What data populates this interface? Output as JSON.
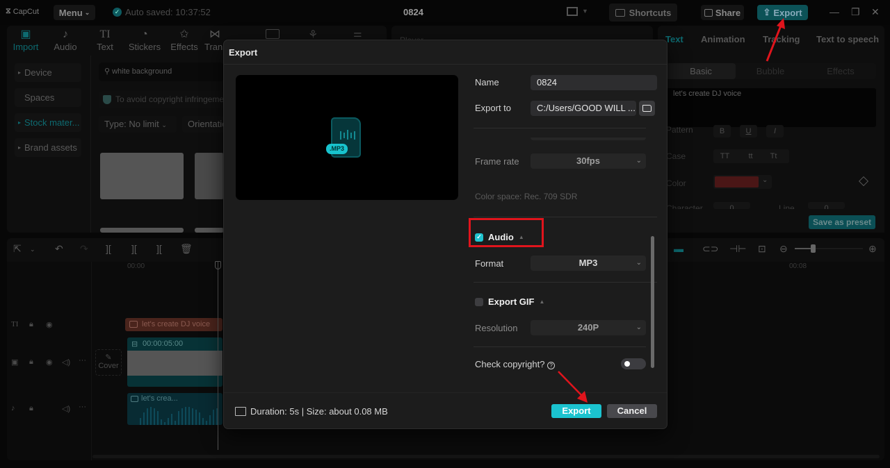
{
  "app": {
    "logo": "CapCut",
    "menu_label": "Menu",
    "autosave": "Auto saved: 10:37:52",
    "project_title": "0824",
    "shortcuts_label": "Shortcuts",
    "share_label": "Share",
    "export_label": "Export"
  },
  "toolbar": {
    "tabs": [
      {
        "label": "Import",
        "icon": "import-icon",
        "glyph": "▣",
        "active": true
      },
      {
        "label": "Audio",
        "icon": "audio-icon",
        "glyph": "♪"
      },
      {
        "label": "Text",
        "icon": "text-icon",
        "glyph": "TI"
      },
      {
        "label": "Stickers",
        "icon": "sticker-icon",
        "glyph": "◔"
      },
      {
        "label": "Effects",
        "icon": "effects-icon",
        "glyph": "✩"
      },
      {
        "label": "Transitions",
        "icon": "transition-icon",
        "glyph": "⋈"
      }
    ]
  },
  "sidebar": {
    "items": [
      {
        "label": "Device",
        "arrow": "▸"
      },
      {
        "label": "Spaces",
        "arrow": ""
      },
      {
        "label": "Stock mater...",
        "arrow": "▸",
        "active": true
      },
      {
        "label": "Brand assets",
        "arrow": "▸"
      }
    ]
  },
  "media": {
    "search_value": "white background",
    "notice": "To avoid copyright infringement",
    "filter_type": "Type: No limit",
    "filter_orientation": "Orientation"
  },
  "player": {
    "title": "Player"
  },
  "right_panel": {
    "tabs": [
      "Text",
      "Animation",
      "Tracking",
      "Text to speech"
    ],
    "segments": [
      "Basic",
      "Bubble",
      "Effects"
    ],
    "text_value": "let's create DJ voice",
    "pattern_label": "Pattern",
    "pattern_buttons": [
      "B",
      "U",
      "I"
    ],
    "case_label": "Case",
    "case_buttons": [
      "TT",
      "tt",
      "Tt"
    ],
    "color_label": "Color",
    "color_value": "#4a1616",
    "character_label": "Character",
    "character_value": "0",
    "line_label": "Line",
    "line_value": "0",
    "save_preset_label": "Save as preset"
  },
  "timeline": {
    "ruler_start": "00:00",
    "ruler_end": "00:08",
    "text_clip": "let's create DJ voice",
    "video_clip_duration": "00:00:05:00",
    "audio_clip": "let's crea...",
    "cover_label": "Cover"
  },
  "export_dialog": {
    "title": "Export",
    "preview_tag": ".MP3",
    "name_label": "Name",
    "name_value": "0824",
    "export_to_label": "Export to",
    "export_to_value": "C:/Users/GOOD WILL ...",
    "frame_rate_label": "Frame rate",
    "frame_rate_value": "30fps",
    "color_space": "Color space: Rec. 709 SDR",
    "audio_label": "Audio",
    "audio_checked": true,
    "format_label": "Format",
    "format_value": "MP3",
    "gif_label": "Export GIF",
    "gif_checked": false,
    "resolution_label": "Resolution",
    "resolution_value": "240P",
    "copyright_label": "Check copyright?",
    "copyright_enabled": false,
    "footer_info": "Duration: 5s | Size: about 0.08 MB",
    "export_button": "Export",
    "cancel_button": "Cancel"
  },
  "colors": {
    "accent": "#1bc3cf",
    "annotation_red": "#e0141c"
  }
}
